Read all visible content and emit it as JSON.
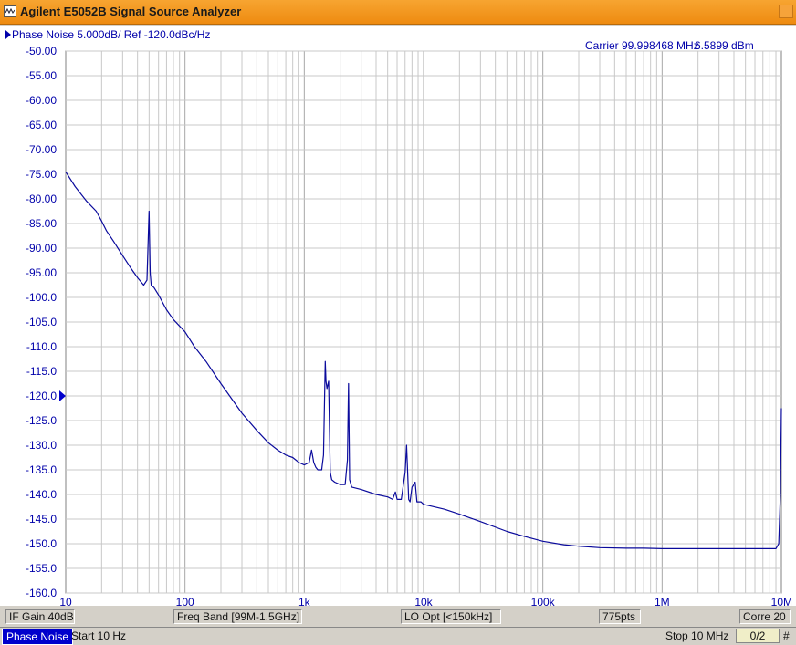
{
  "window": {
    "title": "Agilent E5052B Signal Source Analyzer",
    "app_icon": "waveform-icon",
    "close_icon": "close-icon"
  },
  "trace": {
    "header": "Phase Noise 5.000dB/ Ref -120.0dBc/Hz",
    "carrier_label": "Carrier 99.998468 MHz",
    "carrier_level": "6.5899 dBm",
    "ref_marker": "-120.0"
  },
  "status": {
    "if_gain": "IF Gain 40dB",
    "freq_band": "Freq Band [99M-1.5GHz]",
    "lo_opt": "LO Opt [<150kHz]",
    "points": "775pts",
    "corre": "Corre 20"
  },
  "bottom": {
    "mode": "Phase Noise",
    "start": "Start 10 Hz",
    "stop": "Stop 10 MHz",
    "page": "0/2",
    "hash": "#"
  },
  "colors": {
    "trace": "#0a0a9c",
    "axis_text": "#0000aa",
    "title_bar": "#f29a24"
  },
  "chart_data": {
    "type": "line",
    "title": "Phase Noise 5.000dB/ Ref -120.0dBc/Hz",
    "xscale": "log",
    "xlim": [
      10,
      10000000
    ],
    "ylim": [
      -160,
      -50
    ],
    "x_ticks": [
      "10",
      "100",
      "1k",
      "10k",
      "100k",
      "1M",
      "10M"
    ],
    "y_ticks": [
      "-50.00",
      "-55.00",
      "-60.00",
      "-65.00",
      "-70.00",
      "-75.00",
      "-80.00",
      "-85.00",
      "-90.00",
      "-95.00",
      "-100.0",
      "-105.0",
      "-110.0",
      "-115.0",
      "-120.0",
      "-125.0",
      "-130.0",
      "-135.0",
      "-140.0",
      "-145.0",
      "-150.0",
      "-155.0",
      "-160.0"
    ],
    "grid": true,
    "series": [
      {
        "x": [
          10,
          12,
          15,
          18,
          20,
          22,
          25,
          30,
          35,
          40,
          45,
          48,
          50,
          51,
          52,
          55,
          60,
          70,
          80,
          100,
          120,
          150,
          200,
          300,
          400,
          500,
          600,
          700,
          800,
          900,
          1000,
          1100,
          1150,
          1200,
          1250,
          1300,
          1400,
          1450,
          1480,
          1500,
          1520,
          1550,
          1600,
          1650,
          1700,
          1800,
          2000,
          2200,
          2300,
          2350,
          2400,
          2500,
          3000,
          4000,
          5000,
          5500,
          5800,
          6000,
          6500,
          7000,
          7200,
          7500,
          7700,
          8000,
          8500,
          8800,
          9000,
          9500,
          10000,
          15000,
          20000,
          30000,
          50000,
          70000,
          100000,
          150000,
          200000,
          300000,
          500000,
          700000,
          1000000,
          2000000,
          5000000,
          8000000,
          9000000,
          9500000,
          9800000,
          10000000
        ],
        "y": [
          -74.5,
          -77.5,
          -80.5,
          -82.5,
          -84.5,
          -86.5,
          -88.5,
          -91.5,
          -94.0,
          -96.0,
          -97.5,
          -96.5,
          -82.5,
          -95.0,
          -97.5,
          -98.0,
          -99.5,
          -102.5,
          -104.5,
          -107.0,
          -110.0,
          -113.0,
          -117.5,
          -123.5,
          -127.0,
          -129.5,
          -131.0,
          -132.0,
          -132.5,
          -133.5,
          -134.0,
          -133.5,
          -131.0,
          -133.5,
          -134.5,
          -135.0,
          -135.0,
          -132.0,
          -120.0,
          -113.0,
          -117.0,
          -118.5,
          -117.0,
          -135.5,
          -137.0,
          -137.5,
          -138.0,
          -138.0,
          -133.0,
          -117.5,
          -137.0,
          -138.5,
          -139.0,
          -140.0,
          -140.5,
          -141.0,
          -139.5,
          -141.0,
          -141.0,
          -135.5,
          -130.0,
          -141.0,
          -141.5,
          -138.5,
          -137.5,
          -141.5,
          -141.5,
          -141.5,
          -142.0,
          -143.0,
          -144.0,
          -145.5,
          -147.5,
          -148.5,
          -149.5,
          -150.2,
          -150.5,
          -150.8,
          -150.9,
          -150.9,
          -151.0,
          -151.0,
          -151.0,
          -151.0,
          -151.0,
          -150.0,
          -140.0,
          -122.5
        ]
      }
    ]
  }
}
